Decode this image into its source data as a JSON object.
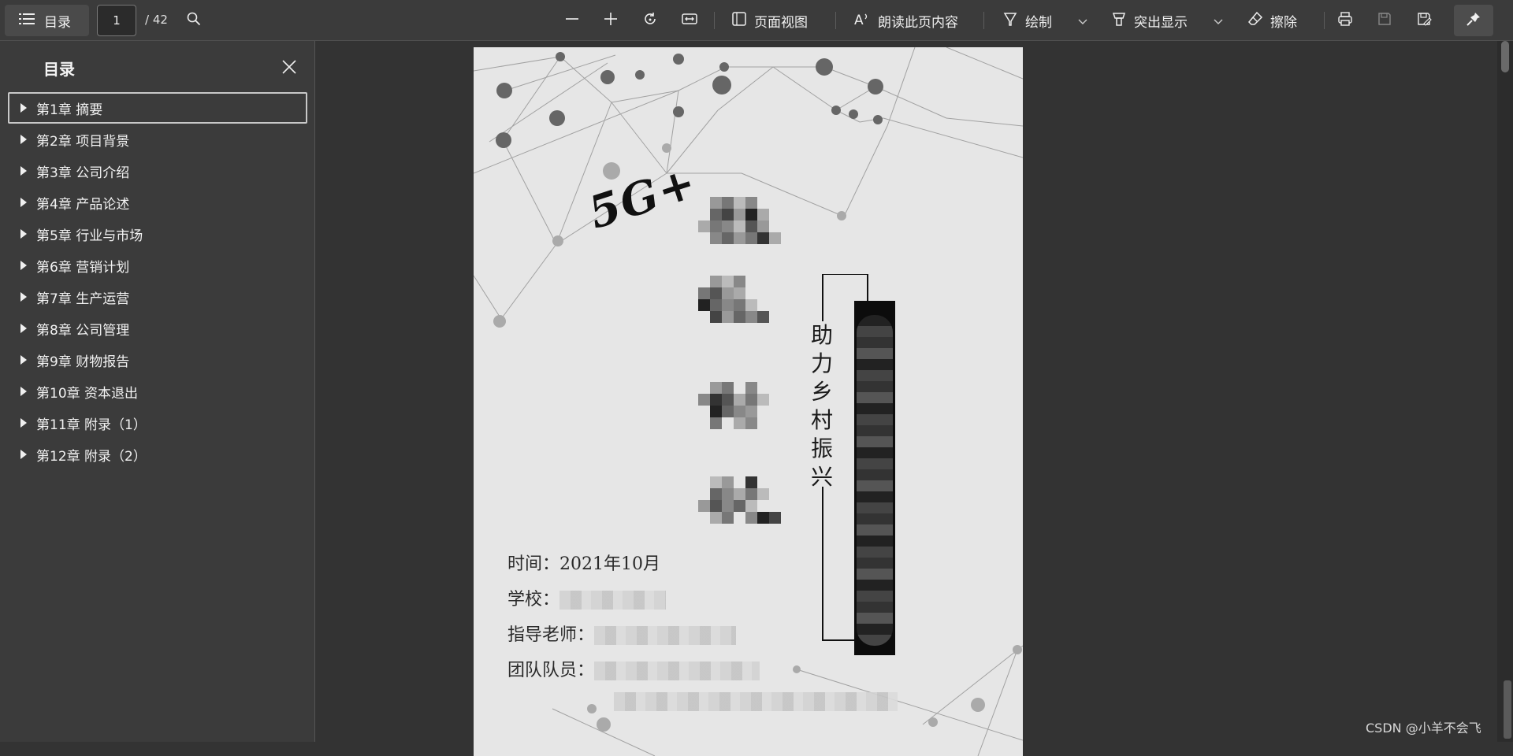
{
  "toolbar": {
    "toc_label": "目录",
    "page_current": "1",
    "page_total": "/ 42",
    "page_view_label": "页面视图",
    "read_aloud_label": "朗读此页内容",
    "draw_label": "绘制",
    "highlight_label": "突出显示",
    "erase_label": "擦除"
  },
  "sidebar": {
    "title": "目录",
    "items": [
      {
        "label": "第1章 摘要"
      },
      {
        "label": "第2章 项目背景"
      },
      {
        "label": "第3章 公司介绍"
      },
      {
        "label": "第4章 产品论述"
      },
      {
        "label": "第5章 行业与市场"
      },
      {
        "label": "第6章 营销计划"
      },
      {
        "label": "第7章 生产运营"
      },
      {
        "label": "第8章 公司管理"
      },
      {
        "label": "第9章 财物报告"
      },
      {
        "label": "第10章 资本退出"
      },
      {
        "label": "第11章 附录（1）"
      },
      {
        "label": "第12章 附录（2）"
      }
    ]
  },
  "document": {
    "logo_text": "5G+",
    "slogan": "助力乡村振兴",
    "time_line": "时间：2021年10月",
    "school_label": "学校：",
    "advisor_label": "指导老师：",
    "team_label": "团队队员："
  },
  "watermark": "CSDN @小羊不会飞",
  "colors": {
    "toolbar_bg": "#3b3b3b",
    "sidebar_bg": "#3b3b3b",
    "doc_bg": "#333333",
    "page_bg": "#e6e6e6"
  }
}
